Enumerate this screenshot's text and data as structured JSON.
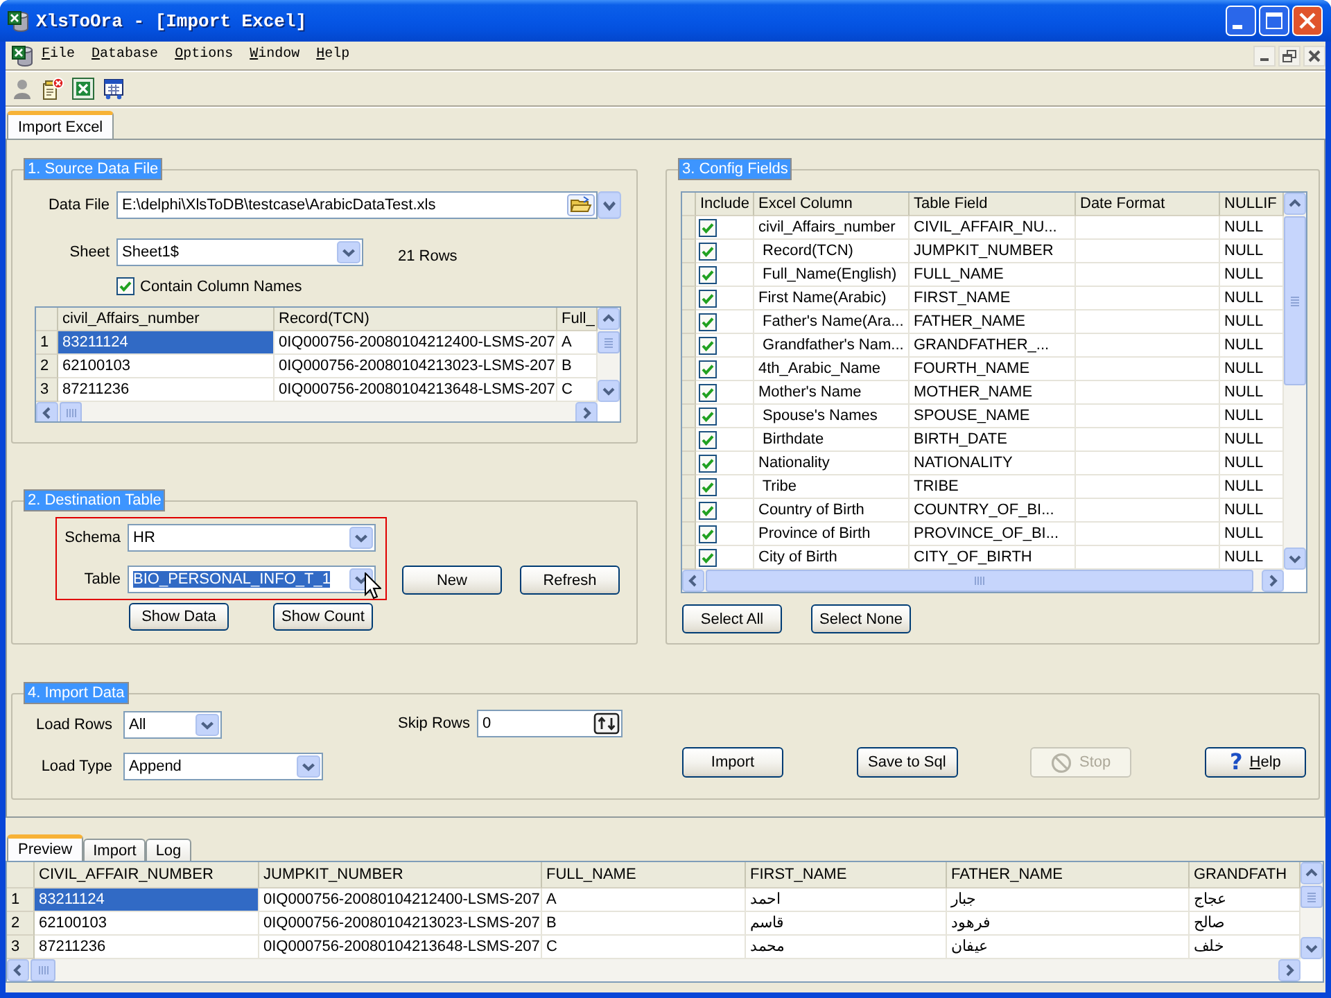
{
  "window": {
    "title": "XlsToOra - [Import Excel]"
  },
  "menu": [
    "File",
    "Database",
    "Options",
    "Window",
    "Help"
  ],
  "doc_tabs": [
    {
      "label": "Import Excel",
      "selected": true
    }
  ],
  "source": {
    "title": "1. Source Data File",
    "data_file": {
      "label": "Data File",
      "value": "E:\\delphi\\XlsToDB\\testcase\\ArabicDataTest.xls"
    },
    "sheet": {
      "label": "Sheet",
      "value": "Sheet1$"
    },
    "row_count": "21 Rows",
    "contain_column_names": {
      "label": "Contain Column Names",
      "checked": true
    },
    "grid": {
      "columns": [
        "civil_Affairs_number",
        "Record(TCN)",
        "Full_"
      ],
      "rows": [
        {
          "number": "1",
          "selected": true,
          "cells": [
            "83211124",
            "0IQ000756-20080104212400-LSMS-207",
            "A"
          ]
        },
        {
          "number": "2",
          "selected": false,
          "cells": [
            "62100103",
            "0IQ000756-20080104213023-LSMS-207",
            "B"
          ]
        },
        {
          "number": "3",
          "selected": false,
          "cells": [
            "87211236",
            "0IQ000756-20080104213648-LSMS-207",
            "C"
          ]
        }
      ]
    }
  },
  "destination": {
    "title": "2. Destination Table",
    "schema": {
      "label": "Schema",
      "value": "HR"
    },
    "table": {
      "label": "Table",
      "value": "BIO_PERSONAL_INFO_T_1",
      "highlighted": true
    },
    "side_buttons": [
      "New",
      "Refresh"
    ],
    "lower_buttons": [
      "Show Data",
      "Show Count"
    ]
  },
  "config": {
    "title": "3. Config Fields",
    "columns": [
      "Include",
      "Excel Column",
      "Table Field",
      "Date Format",
      "NULLIF"
    ],
    "rows": [
      {
        "include": true,
        "excel_column": "civil_Affairs_number",
        "table_field": "CIVIL_AFFAIR_NU...",
        "nullif": "NULL"
      },
      {
        "include": true,
        "excel_column": " Record(TCN)",
        "table_field": "JUMPKIT_NUMBER",
        "nullif": "NULL"
      },
      {
        "include": true,
        "excel_column": " Full_Name(English)",
        "table_field": "FULL_NAME",
        "nullif": "NULL"
      },
      {
        "include": true,
        "excel_column": "First Name(Arabic)",
        "table_field": "FIRST_NAME",
        "nullif": "NULL"
      },
      {
        "include": true,
        "excel_column": " Father's Name(Ara...",
        "table_field": "FATHER_NAME",
        "nullif": "NULL"
      },
      {
        "include": true,
        "excel_column": " Grandfather's Nam...",
        "table_field": "GRANDFATHER_...",
        "nullif": "NULL"
      },
      {
        "include": true,
        "excel_column": "4th_Arabic_Name",
        "table_field": "FOURTH_NAME",
        "nullif": "NULL"
      },
      {
        "include": true,
        "excel_column": "Mother's Name",
        "table_field": "MOTHER_NAME",
        "nullif": "NULL"
      },
      {
        "include": true,
        "excel_column": " Spouse's Names",
        "table_field": "SPOUSE_NAME",
        "nullif": "NULL"
      },
      {
        "include": true,
        "excel_column": " Birthdate",
        "table_field": "BIRTH_DATE",
        "nullif": "NULL"
      },
      {
        "include": true,
        "excel_column": "Nationality",
        "table_field": "NATIONALITY",
        "nullif": "NULL"
      },
      {
        "include": true,
        "excel_column": " Tribe",
        "table_field": "TRIBE",
        "nullif": "NULL"
      },
      {
        "include": true,
        "excel_column": "Country of Birth",
        "table_field": "COUNTRY_OF_BI...",
        "nullif": "NULL"
      },
      {
        "include": true,
        "excel_column": "Province of Birth",
        "table_field": "PROVINCE_OF_BI...",
        "nullif": "NULL"
      },
      {
        "include": true,
        "excel_column": "City of Birth",
        "table_field": "CITY_OF_BIRTH",
        "nullif": "NULL"
      }
    ],
    "buttons": [
      "Select All",
      "Select None"
    ]
  },
  "import": {
    "title": "4. Import Data",
    "load_rows": {
      "label": "Load Rows",
      "value": "All"
    },
    "load_type": {
      "label": "Load Type",
      "value": "Append"
    },
    "skip_rows": {
      "label": "Skip Rows",
      "value": "0"
    },
    "buttons": [
      {
        "label": "Import",
        "kind": "plain",
        "disabled": false
      },
      {
        "label": "Save to Sql",
        "kind": "plain",
        "disabled": false
      },
      {
        "label": "Stop",
        "kind": "stop",
        "disabled": true
      },
      {
        "label": "Help",
        "kind": "help",
        "icon": "?",
        "disabled": false
      }
    ]
  },
  "results": {
    "tabs": [
      {
        "label": "Preview",
        "selected": true
      },
      {
        "label": "Import",
        "selected": false
      },
      {
        "label": "Log",
        "selected": false
      }
    ],
    "grid": {
      "columns": [
        "CIVIL_AFFAIR_NUMBER",
        "JUMPKIT_NUMBER",
        "FULL_NAME",
        "FIRST_NAME",
        "FATHER_NAME",
        "GRANDFATH"
      ],
      "rows": [
        {
          "number": "1",
          "selected": true,
          "cells": [
            "83211124",
            "0IQ000756-20080104212400-LSMS-207",
            "A",
            "احمد",
            "جبار",
            "عجاج"
          ]
        },
        {
          "number": "2",
          "selected": false,
          "cells": [
            "62100103",
            "0IQ000756-20080104213023-LSMS-207",
            "B",
            "قاسم",
            "فرهود",
            "صالح"
          ]
        },
        {
          "number": "3",
          "selected": false,
          "cells": [
            "87211236",
            "0IQ000756-20080104213648-LSMS-207",
            "C",
            "محمد",
            "عيفان",
            "خلف"
          ]
        }
      ]
    }
  }
}
